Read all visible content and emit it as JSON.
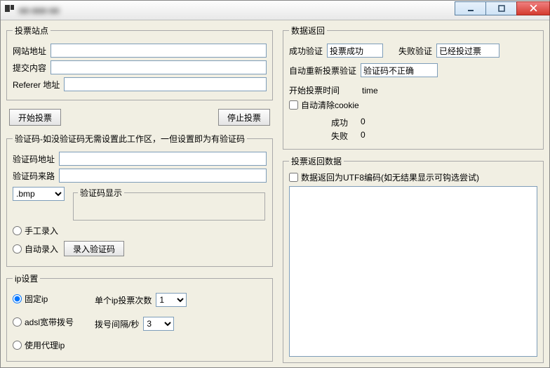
{
  "window": {
    "title": "■■  ■■■ ■■"
  },
  "site": {
    "legend": "投票站点",
    "url_label": "网站地址",
    "url_value": "",
    "submit_label": "提交内容",
    "submit_value": "",
    "referer_label": "Referer 地址",
    "referer_value": ""
  },
  "actions": {
    "start": "开始投票",
    "stop": "停止投票"
  },
  "captcha": {
    "legend": "验证码-如没验证码无需设置此工作区，一但设置即为有验证码",
    "addr_label": "验证码地址",
    "addr_value": "",
    "ref_label": "验证码来路",
    "ref_value": "",
    "ext_value": ".bmp",
    "display_legend": "验证码显示",
    "manual_label": "手工录入",
    "auto_label": "自动录入",
    "auto_btn": "录入验证码"
  },
  "ip": {
    "legend": "ip设置",
    "fixed": "固定ip",
    "adsl": "adsl宽带拨号",
    "proxy": "使用代理ip",
    "per_ip_label": "单个ip投票次数",
    "per_ip_value": "1",
    "interval_label": "拨号间隔/秒",
    "interval_value": "3"
  },
  "result": {
    "legend": "数据返回",
    "success_label": "成功验证",
    "success_value": "投票成功",
    "fail_label": "失败验证",
    "fail_value": "已经投过票",
    "retry_label": "自动重新投票验证",
    "retry_value": "验证码不正确",
    "start_time_label": "开始投票时间",
    "start_time_value": "time",
    "clear_cookie": "自动清除cookie",
    "succ_count_label": "成功",
    "succ_count_value": "0",
    "fail_count_label": "失败",
    "fail_count_value": "0"
  },
  "return_data": {
    "legend": "投票返回数据",
    "utf8_label": "数据返回为UTF8编码(如无结果显示可钩选尝试)"
  }
}
